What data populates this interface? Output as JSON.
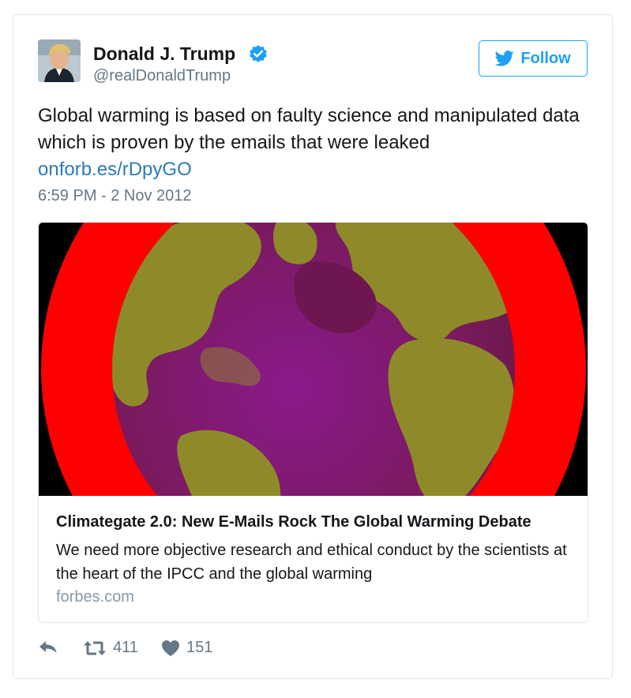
{
  "user": {
    "display_name": "Donald J. Trump",
    "handle": "@realDonaldTrump",
    "verified": true,
    "verified_icon": "verified-badge-icon"
  },
  "follow": {
    "label": "Follow",
    "icon": "twitter-bird-icon"
  },
  "tweet": {
    "text": "Global warming is based on faulty science and manipulated data which is proven by the emails that were leaked",
    "link": "onforb.es/rDpyGO",
    "timestamp": "6:59 PM - 2 Nov 2012"
  },
  "card": {
    "title": "Climategate 2.0: New E-Mails Rock The Global Warming Debate",
    "description": "We need more objective research and ethical conduct by the scientists at the heart of the IPCC and the global warming",
    "domain": "forbes.com"
  },
  "actions": {
    "reply": {
      "icon": "reply-icon"
    },
    "retweet": {
      "icon": "retweet-icon",
      "count": "411"
    },
    "like": {
      "icon": "heart-icon",
      "count": "151"
    }
  },
  "colors": {
    "link": "#2b7bb9",
    "follow_blue": "#1da1f2",
    "muted": "#657786",
    "border": "#e1e8ed"
  }
}
